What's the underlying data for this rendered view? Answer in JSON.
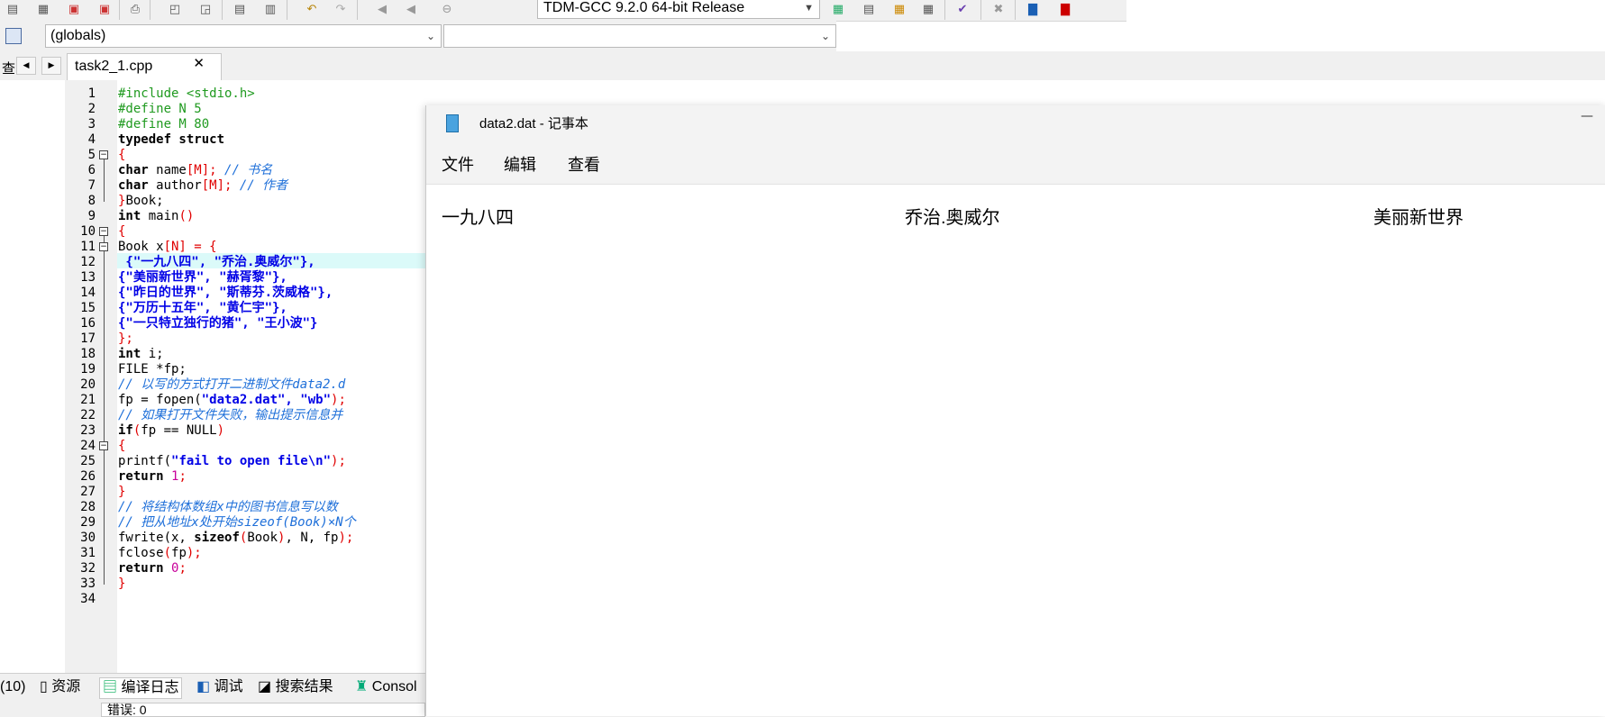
{
  "toolbar": {
    "compiler": "TDM-GCC 9.2.0 64-bit Release",
    "icons": [
      "new-file-icon",
      "save-icon",
      "save-all-icon",
      "close-file-icon",
      "print-icon",
      "find-icon",
      "replace-icon",
      "goto-icon",
      "bookmark-icon",
      "undo-icon",
      "redo-icon",
      "compile-icon",
      "run-icon",
      "stop-icon",
      "layout-icon",
      "window-icon",
      "grid-icon",
      "check-icon",
      "delete-icon",
      "chart-icon",
      "profile-icon"
    ]
  },
  "globals_bar": {
    "scope_combo": "(globals)",
    "member_combo": ""
  },
  "tabs": {
    "side_label": "查",
    "file_tab": "task2_1.cpp",
    "close_glyph": "✕"
  },
  "editor": {
    "line_numbers": [
      "1",
      "2",
      "3",
      "4",
      "5",
      "6",
      "7",
      "8",
      "9",
      "10",
      "11",
      "12",
      "13",
      "14",
      "15",
      "16",
      "17",
      "18",
      "19",
      "20",
      "21",
      "22",
      "23",
      "24",
      "25",
      "26",
      "27",
      "28",
      "29",
      "30",
      "31",
      "32",
      "33",
      "34"
    ],
    "lines": [
      [
        [
          "pp",
          "#include <stdio.h>"
        ]
      ],
      [
        [
          "pp",
          "#define N 5"
        ]
      ],
      [
        [
          "pp",
          "#define M 80"
        ]
      ],
      [
        [
          "kw",
          "typedef struct"
        ]
      ],
      [
        [
          "br",
          "{"
        ]
      ],
      [
        [
          "kw",
          "char"
        ],
        [
          "nm",
          " name"
        ],
        [
          "br",
          "[M];"
        ],
        [
          "cm",
          " // 书名"
        ]
      ],
      [
        [
          "kw",
          "char"
        ],
        [
          "nm",
          " author"
        ],
        [
          "br",
          "[M];"
        ],
        [
          "cm",
          " // 作者"
        ]
      ],
      [
        [
          "br",
          "}"
        ],
        [
          "nm",
          "Book;"
        ]
      ],
      [
        [
          "kw",
          "int"
        ],
        [
          "nm",
          " main"
        ],
        [
          "br",
          "()"
        ]
      ],
      [
        [
          "br",
          "{"
        ]
      ],
      [
        [
          "nm",
          "Book x"
        ],
        [
          "br",
          "[N] = {"
        ]
      ],
      [
        [
          "str",
          " {\"一九八四\", \"乔治.奥威尔\"},"
        ]
      ],
      [
        [
          "str",
          "{\"美丽新世界\", \"赫胥黎\"},"
        ]
      ],
      [
        [
          "str",
          "{\"昨日的世界\", \"斯蒂芬.茨威格\"},"
        ]
      ],
      [
        [
          "str",
          "{\"万历十五年\", \"黄仁宇\"},"
        ]
      ],
      [
        [
          "str",
          "{\"一只特立独行的猪\", \"王小波\"}"
        ]
      ],
      [
        [
          "br",
          "};"
        ]
      ],
      [
        [
          "kw",
          "int"
        ],
        [
          "nm",
          " i;"
        ]
      ],
      [
        [
          "nm",
          "FILE *fp;"
        ]
      ],
      [
        [
          "cm",
          "// 以写的方式打开二进制文件data2.d"
        ]
      ],
      [
        [
          "nm",
          "fp = fopen("
        ],
        [
          "str",
          "\"data2.dat\", \"wb\""
        ],
        [
          "br",
          ");"
        ]
      ],
      [
        [
          "cm",
          "// 如果打开文件失败，输出提示信息并"
        ]
      ],
      [
        [
          "kw",
          "if"
        ],
        [
          "br",
          "("
        ],
        [
          "nm",
          "fp == NULL"
        ],
        [
          "br",
          ")"
        ]
      ],
      [
        [
          "br",
          "{"
        ]
      ],
      [
        [
          "nm",
          "printf("
        ],
        [
          "str",
          "\"fail to open file\\n\""
        ],
        [
          "br",
          ");"
        ]
      ],
      [
        [
          "kw",
          "return"
        ],
        [
          "num",
          " 1"
        ],
        [
          "br",
          ";"
        ]
      ],
      [
        [
          "br",
          "}"
        ]
      ],
      [
        [
          "cm",
          "// 将结构体数组x中的图书信息写以数"
        ]
      ],
      [
        [
          "cm",
          "// 把从地址x处开始sizeof(Book)×N个"
        ]
      ],
      [
        [
          "nm",
          "fwrite(x, "
        ],
        [
          "kw",
          "sizeof"
        ],
        [
          "br",
          "("
        ],
        [
          "nm",
          "Book"
        ],
        [
          "br",
          ")"
        ],
        [
          "nm",
          ", N, fp"
        ],
        [
          "br",
          ");"
        ]
      ],
      [
        [
          "nm",
          "fclose"
        ],
        [
          "br",
          "("
        ],
        [
          "nm",
          "fp"
        ],
        [
          "br",
          ");"
        ]
      ],
      [
        [
          "kw",
          "return"
        ],
        [
          "num",
          " 0"
        ],
        [
          "br",
          ";"
        ]
      ],
      [
        [
          "br",
          "}"
        ]
      ],
      []
    ]
  },
  "bottom_tabs": [
    {
      "label": "(10)",
      "icon": ""
    },
    {
      "label": "资源",
      "icon": "resource-icon"
    },
    {
      "label": "编译日志",
      "icon": "compile-log-icon"
    },
    {
      "label": "调试",
      "icon": "debug-icon"
    },
    {
      "label": "搜索结果",
      "icon": "search-results-icon"
    },
    {
      "label": "Consol",
      "icon": "console-icon"
    }
  ],
  "bottom_status": "错误: 0",
  "notepad": {
    "title": "data2.dat - 记事本",
    "menu": [
      "文件",
      "编辑",
      "查看"
    ],
    "content": [
      "一九八四",
      "乔治.奥威尔",
      "美丽新世界"
    ]
  },
  "colors": {
    "preprocessor": "#1f9a1f",
    "bracket": "#e00000",
    "comment": "#1e6fd9",
    "string": "#0000e6",
    "highlight": "#dbfaf9"
  }
}
